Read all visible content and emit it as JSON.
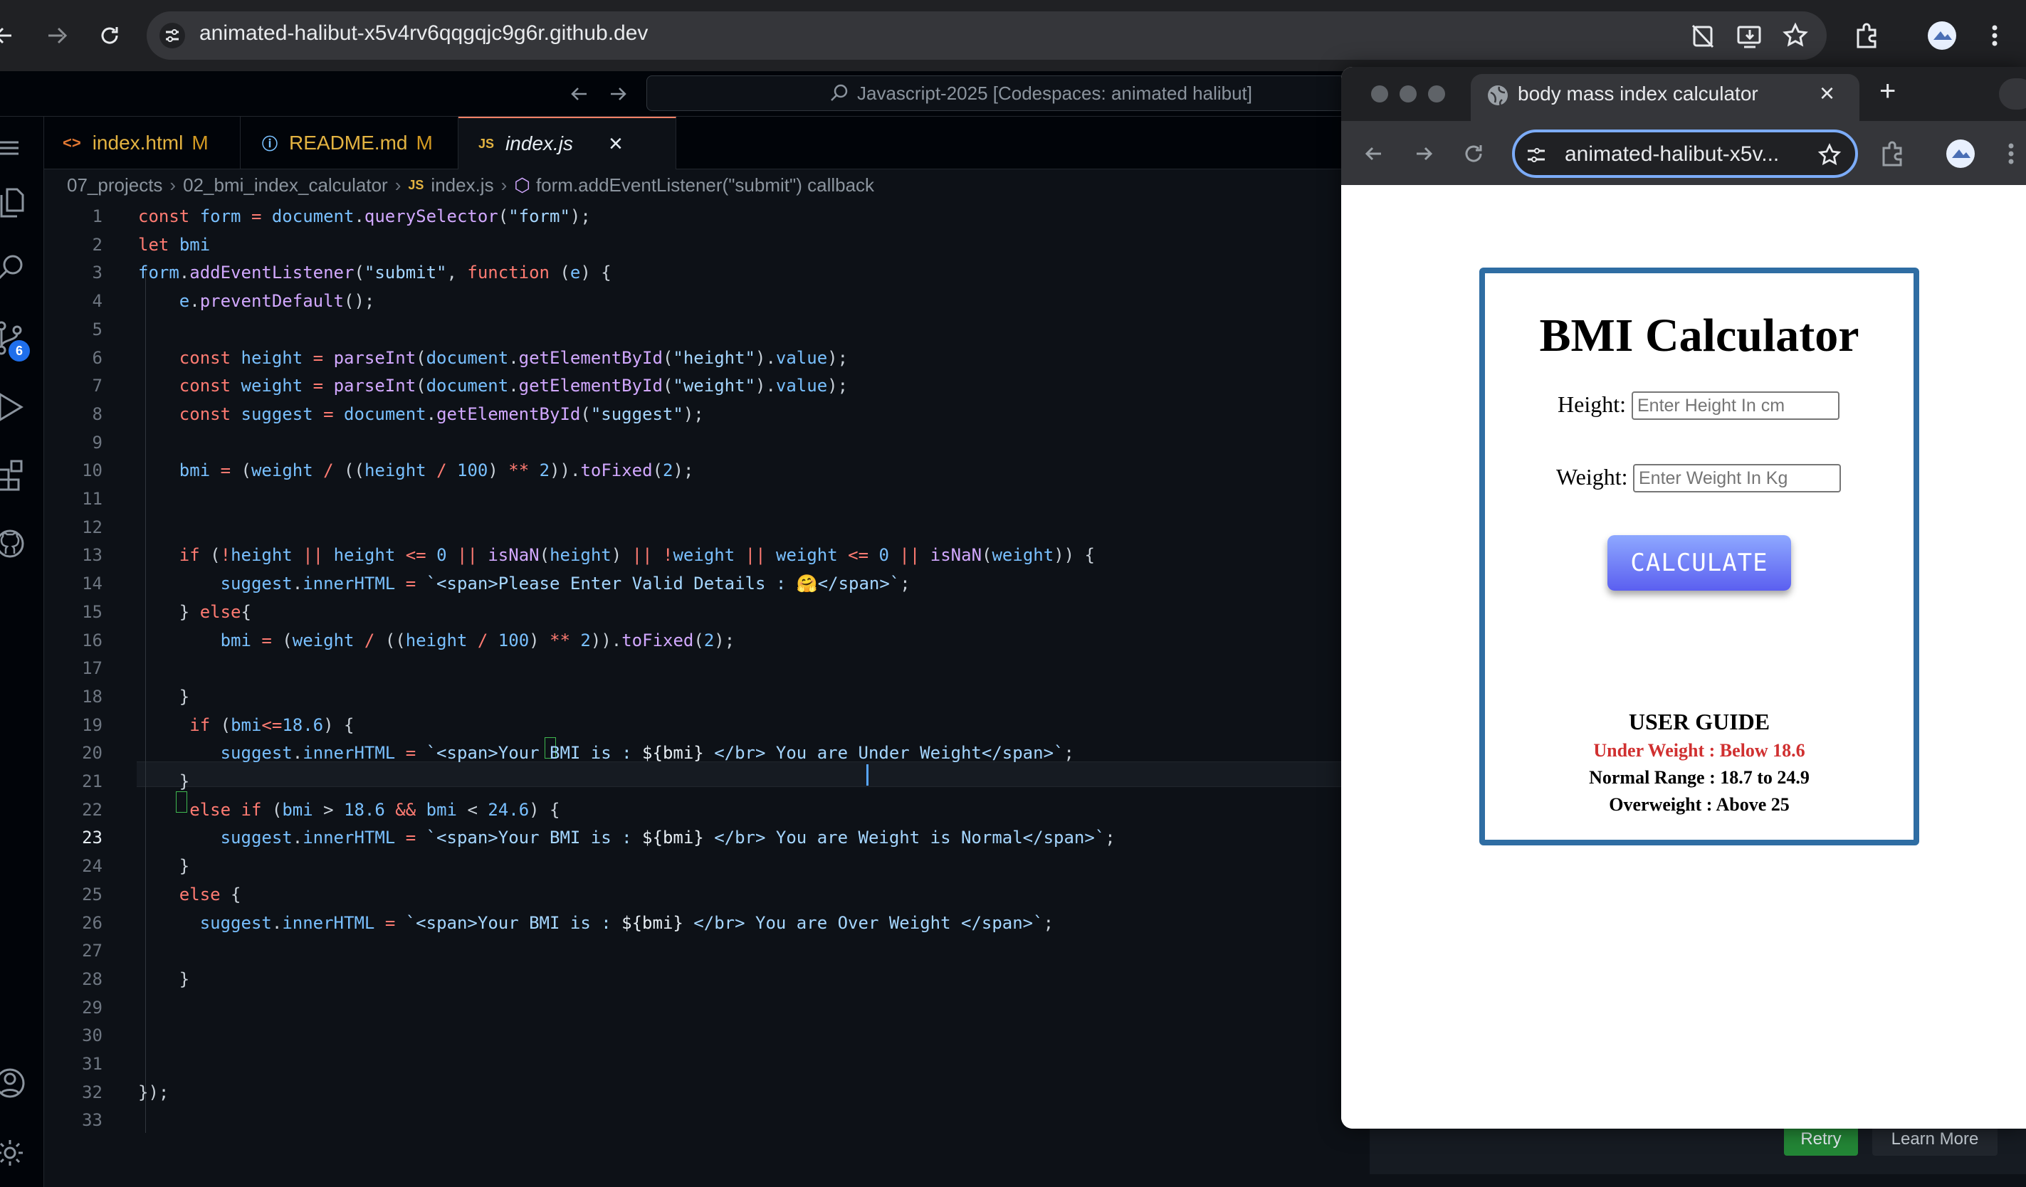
{
  "browser": {
    "url": "animated-halibut-x5v4rv6qqgqjc9g6r.github.dev"
  },
  "vscode": {
    "command_center": "Javascript-2025 [Codespaces: animated halibut]",
    "scm_badge": "6",
    "tabs": [
      {
        "icon": "<>",
        "label": "index.html",
        "badge": "M"
      },
      {
        "icon": "ⓘ",
        "label": "README.md",
        "badge": "M"
      },
      {
        "icon": "JS",
        "label": "index.js",
        "badge": "×"
      }
    ],
    "breadcrumb": [
      "07_projects",
      "02_bmi_index_calculator",
      "JS",
      "index.js",
      "form.addEventListener(\"submit\") callback"
    ],
    "line_numbers": [
      "1",
      "2",
      "3",
      "4",
      "5",
      "6",
      "7",
      "8",
      "9",
      "10",
      "11",
      "12",
      "13",
      "14",
      "15",
      "16",
      "17",
      "18",
      "19",
      "20",
      "21",
      "22",
      "23",
      "24",
      "25",
      "26",
      "27",
      "28",
      "29",
      "30",
      "31",
      "32",
      "33"
    ],
    "code_lines": [
      "const form = document.querySelector(\"form\");",
      "let bmi",
      "form.addEventListener(\"submit\", function (e) {",
      "    e.preventDefault();",
      "",
      "    const height = parseInt(document.getElementById(\"height\").value);",
      "    const weight = parseInt(document.getElementById(\"weight\").value);",
      "    const suggest = document.getElementById(\"suggest\");",
      "",
      "    bmi = (weight / ((height / 100) ** 2)).toFixed(2);",
      "",
      "",
      "    if (!height || height <= 0 || isNaN(height) || !weight || weight <= 0 || isNaN(weight)) {",
      "        suggest.innerHTML = `<span>Please Enter Valid Details : 🤗</span>`;",
      "    } else{",
      "        bmi = (weight / ((height / 100) ** 2)).toFixed(2);",
      "",
      "    }",
      "     if (bmi<=18.6) {",
      "        suggest.innerHTML = `<span>Your BMI is : ${bmi} </br> You are Under Weight</span>`;",
      "    }",
      "     else if (bmi > 18.6 && bmi < 24.6) {",
      "        suggest.innerHTML = `<span>Your BMI is : ${bmi} </br> You are Weight is Normal</span>`;",
      "    }",
      "    else {",
      "      suggest.innerHTML = `<span>Your BMI is : ${bmi} </br> You are Over Weight </span>`;",
      "",
      "    }",
      "",
      "",
      "",
      "});",
      ""
    ],
    "notification": {
      "retry": "Retry",
      "learn_more": "Learn More"
    }
  },
  "preview": {
    "tab_title": "body mass index calculator",
    "url": "animated-halibut-x5v...",
    "page": {
      "title": "BMI Calculator",
      "height_label": "Height:",
      "height_placeholder": "Enter Height In cm",
      "weight_label": "Weight:",
      "weight_placeholder": "Enter Weight In Kg",
      "button": "CALCULATE",
      "guide_title": "USER GUIDE",
      "guide_under": "Under Weight : Below 18.6",
      "guide_normal": "Normal Range : 18.7 to 24.9",
      "guide_over": "Overweight : Above 25"
    }
  },
  "colors": {
    "editor_bg": "#0d1117",
    "card_border": "#2f6da3",
    "button": "#5b5ff0",
    "under_weight": "#d03030"
  }
}
